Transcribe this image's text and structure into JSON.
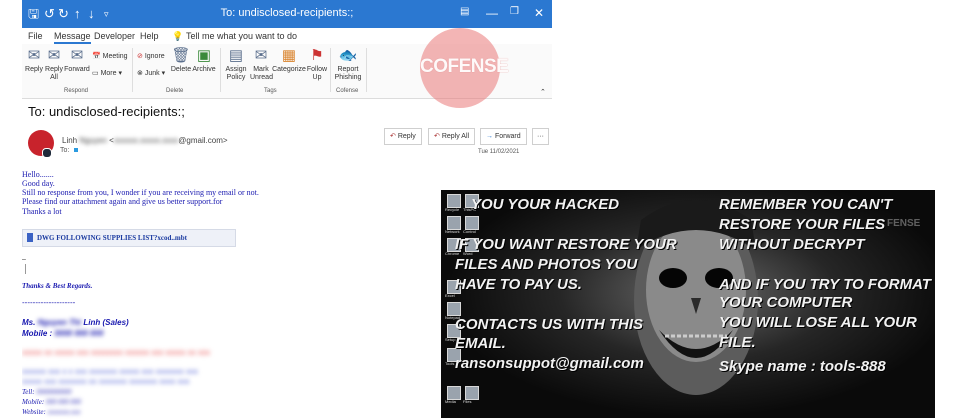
{
  "window": {
    "title": "To: undisclosed-recipients:;"
  },
  "menu": [
    "File",
    "Message",
    "Developer",
    "Help"
  ],
  "tell_me": "Tell me what you want to do",
  "ribbon": {
    "respond": [
      "Reply",
      "Reply\nAll",
      "Forward"
    ],
    "meeting": "Meeting",
    "more": "More",
    "ignore": "Ignore",
    "junk": "Junk",
    "delete": "Delete",
    "archive": "Archive",
    "assign_policy": "Assign\nPolicy",
    "mark_unread": "Mark\nUnread",
    "categorize": "Categorize",
    "follow_up": "Follow\nUp",
    "report_phishing": "Report\nPhishing",
    "groups": {
      "respond": "Respond",
      "delete": "Delete",
      "tags": "Tags",
      "cofense": "Cofense"
    }
  },
  "watermark": "COFENSE",
  "email": {
    "to_line": "To: undisclosed-recipients:;",
    "sender_name": "Linh",
    "sender_hidden_name": "Nguyen",
    "sender_hidden_email": "xxxxxx.xxxxx.xxxx",
    "sender_domain": "@gmail.com>",
    "sender_bracket": "<",
    "to_label": "To:",
    "date": "Tue 11/02/2021",
    "actions": [
      "Reply",
      "Reply All",
      "Forward",
      "···"
    ],
    "body_lines": [
      "Hello.......",
      "Good day.",
      "Still no response from you, I wonder if you are receiving my email or not.",
      "Please find our attachment again and give us better support.for",
      "Thanks a lot"
    ],
    "attachment": "DWG FOLLOWING SUPPLIES LIST?xcod..mbt",
    "signature": {
      "dash": "–",
      "closing": "Thanks & Best Regards.",
      "divider": "--------------------",
      "name_prefix": "Ms.",
      "name_hidden": "Nguyen Thi",
      "name_suffix": "Linh (Sales)",
      "mobile_label": "Mobile :",
      "mobile_hidden": "0000 000 000",
      "company_hidden": "xxxxx xx xxxxx xxx xxxxxxxx xxxxxx xxx xxxxx xx xxx",
      "address_hidden_1": "xxxxxx xxx x x xxx xxxxxxx xxxxx xxx xxxxxxx xxx",
      "address_hidden_2": "xxxxx xxx xxxxxxx xx xxxxxxx xxxxxxx xxxx xxx",
      "tell_label": "Tell:",
      "tell_hidden": "0000000000",
      "mobile2_label": "Mobile:",
      "mobile2_hidden": "000 000 000",
      "website_label": "Website:",
      "website_hidden": "xxxxxxx.xxx"
    }
  },
  "ransom": {
    "left_lines": [
      "YOU   YOUR   HACKED",
      "IF YOU WANT RESTORE YOUR",
      "FILES  AND  PHOTOS YOU",
      "HAVE TO PAY US.",
      "CONTACTS US WITH THIS",
      "EMAIL.",
      "ransonsuppot@gmail.com"
    ],
    "right_lines": [
      "REMEMBER YOU CAN'T",
      "RESTORE YOUR FILES",
      "WITHOUT DECRYPT",
      "AND IF YOU TRY TO FORMAT",
      "YOUR COMPUTER",
      "YOU WILL LOSE ALL YOUR",
      "FILE.",
      "Skype name :  tools-888"
    ],
    "watermark": "FENSE",
    "desktop_labels": [
      "Recycle",
      "ThisPC",
      "Network",
      "Control",
      "Chrome",
      "Word",
      "Excel",
      "Notepad",
      "Setup",
      "Tools",
      "Media",
      "Files"
    ]
  },
  "colors": {
    "title_bar": "#2b78d1",
    "body_text": "#1a1ab0",
    "avatar": "#c8232c"
  }
}
